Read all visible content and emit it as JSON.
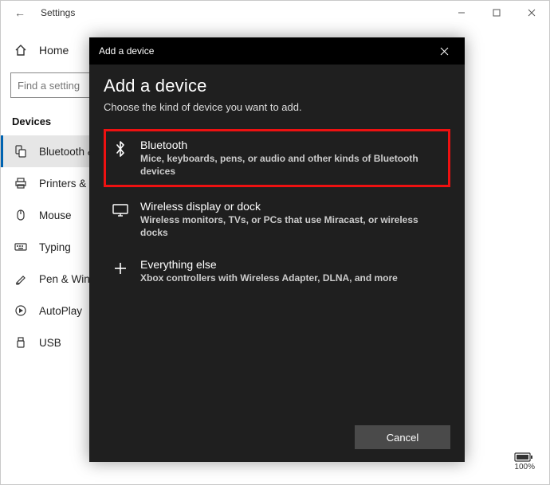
{
  "window": {
    "title": "Settings",
    "controls": {
      "min": "—",
      "max": "▢",
      "close": "✕"
    }
  },
  "sidebar": {
    "home": "Home",
    "search_placeholder": "Find a setting",
    "section": "Devices",
    "items": [
      {
        "label": "Bluetooth & other devices"
      },
      {
        "label": "Printers & scanners"
      },
      {
        "label": "Mouse"
      },
      {
        "label": "Typing"
      },
      {
        "label": "Pen & Windows Ink"
      },
      {
        "label": "AutoPlay"
      },
      {
        "label": "USB"
      }
    ]
  },
  "tray": {
    "battery": "100%"
  },
  "dialog": {
    "titlebar": "Add a device",
    "heading": "Add a device",
    "subheading": "Choose the kind of device you want to add.",
    "options": [
      {
        "title": "Bluetooth",
        "desc": "Mice, keyboards, pens, or audio and other kinds of Bluetooth devices"
      },
      {
        "title": "Wireless display or dock",
        "desc": "Wireless monitors, TVs, or PCs that use Miracast, or wireless docks"
      },
      {
        "title": "Everything else",
        "desc": "Xbox controllers with Wireless Adapter, DLNA, and more"
      }
    ],
    "cancel": "Cancel"
  }
}
